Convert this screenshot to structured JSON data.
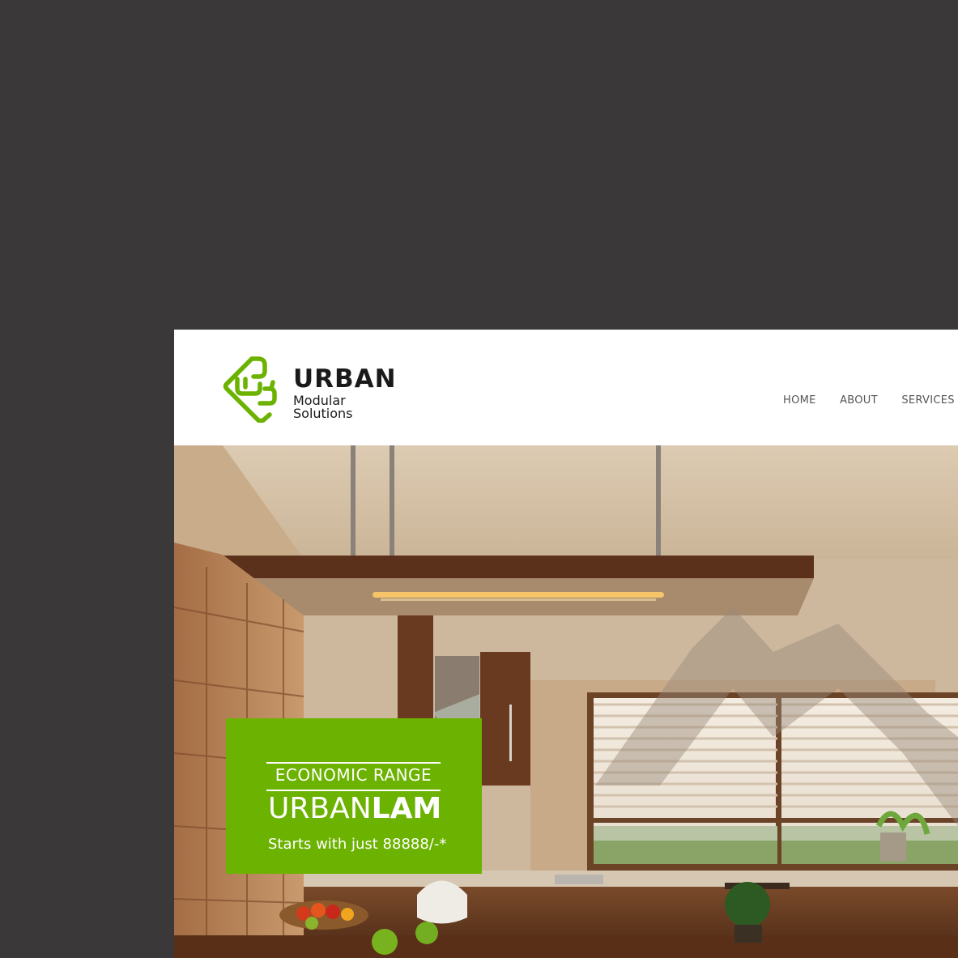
{
  "brand": {
    "name": "URBAN",
    "tagline": "Modular Solutions",
    "logo_color": "#6cb200"
  },
  "nav": {
    "items": [
      {
        "label": "HOME"
      },
      {
        "label": "ABOUT"
      },
      {
        "label": "SERVICES"
      }
    ]
  },
  "hero": {
    "scene": "modular kitchen interior",
    "promo": {
      "kicker": "ECONOMIC RANGE",
      "title_light": "URBAN",
      "title_bold": "LAM",
      "price": "Starts with just 88888/-*",
      "background": "#6cb200"
    }
  },
  "colors": {
    "page_background": "#3a3839",
    "nav_text": "#555555",
    "accent": "#6cb200"
  }
}
